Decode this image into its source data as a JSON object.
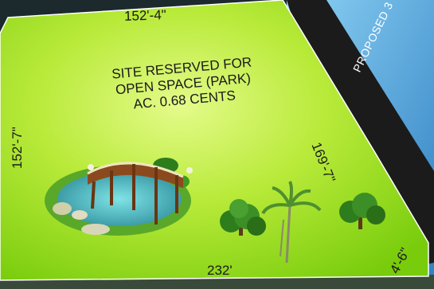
{
  "plot": {
    "title_lines": [
      "SITE RESERVED FOR",
      "OPEN SPACE (PARK)",
      "AC. 0.68 CENTS"
    ],
    "dimensions": {
      "top": "152'-4\"",
      "left": "152'-7\"",
      "right": "169'-7\"",
      "bottom": "232'",
      "corner": "4'-6\""
    }
  },
  "road": {
    "label": "PROPOSED 3"
  },
  "colors": {
    "plot_light": "#d9f77a",
    "plot_mid": "#a6e02a",
    "plot_edge": "#7ccf0e",
    "road": "#1b1b1b",
    "background": "#1c2a2e"
  },
  "icons": [
    "pond-bridge-icon",
    "tree-icon",
    "palm-tree-icon"
  ]
}
